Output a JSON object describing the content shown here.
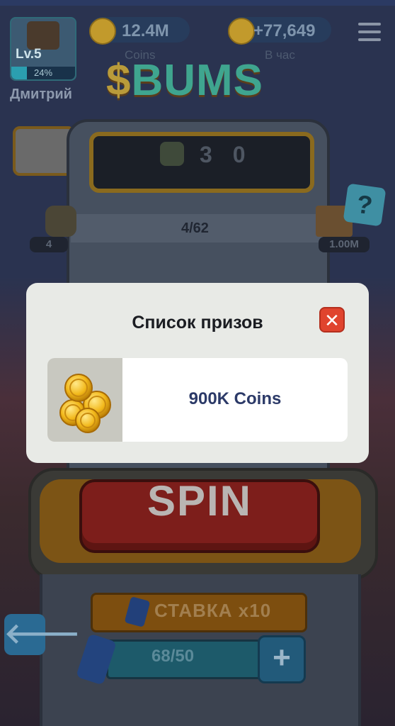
{
  "header": {
    "level": "Lv.5",
    "level_progress_text": "24%",
    "level_progress": 0.24,
    "username": "Дмитрий",
    "coins_value": "12.4M",
    "coins_label": "Coins",
    "per_hour_value": "+77,649",
    "per_hour_label": "В час"
  },
  "logo": {
    "text_prefix": "$",
    "text_main": "BUMS"
  },
  "machine": {
    "counter_value": "3 0",
    "progress": "4/62",
    "left_badge": "4",
    "right_badge": "1.00M",
    "help_symbol": "?"
  },
  "controls": {
    "spin_label": "SPIN",
    "bet_label": "СТАВКА x10",
    "energy": "68/50",
    "plus_symbol": "+",
    "back_symbol": "🡐"
  },
  "modal": {
    "title": "Список призов",
    "close_symbol": "✕",
    "prizes": [
      {
        "label": "900K Coins",
        "icon": "gold-coins-icon"
      }
    ]
  },
  "colors": {
    "modal_bg": "#e8eae6",
    "close_red": "#e0442e",
    "prize_text": "#2c3a68"
  }
}
